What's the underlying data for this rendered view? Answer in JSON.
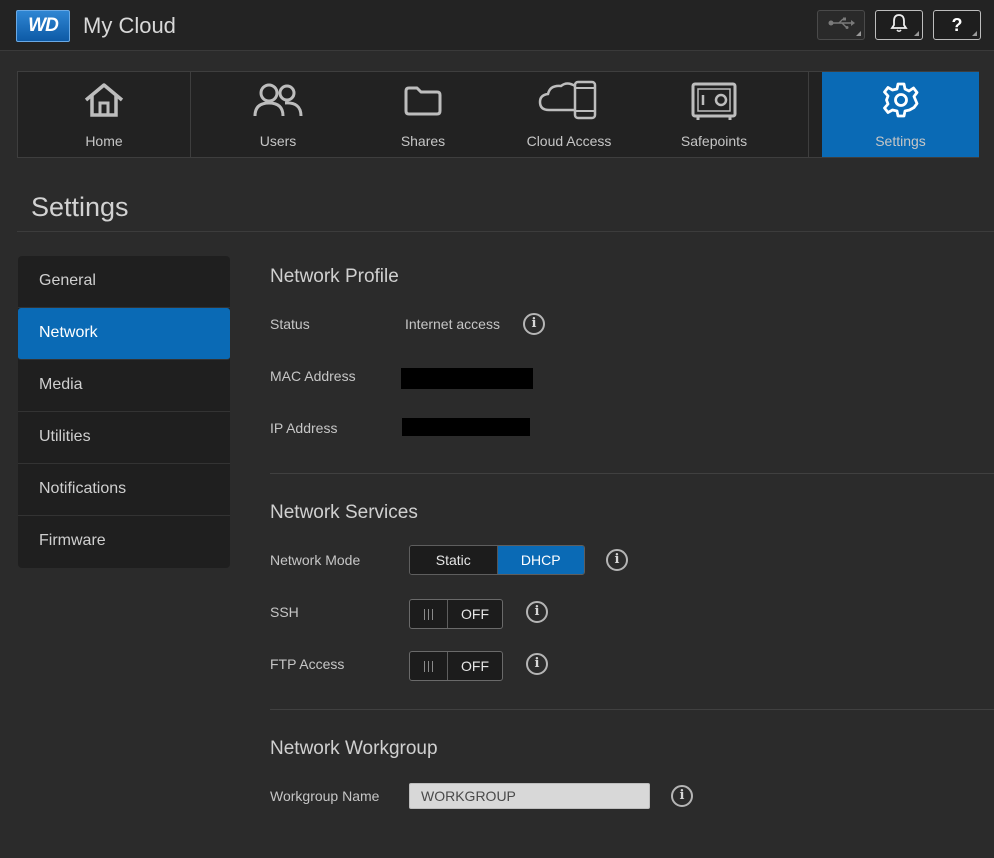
{
  "header": {
    "logo_text": "WD",
    "app_title": "My Cloud",
    "usb_icon": "usb-icon",
    "bell_icon": "bell-icon",
    "help_label": "?"
  },
  "nav": {
    "items": [
      {
        "label": "Home",
        "icon": "home-icon"
      },
      {
        "label": "Users",
        "icon": "users-icon"
      },
      {
        "label": "Shares",
        "icon": "folder-icon"
      },
      {
        "label": "Cloud Access",
        "icon": "cloud-device-icon"
      },
      {
        "label": "Safepoints",
        "icon": "safe-icon"
      },
      {
        "label": "Settings",
        "icon": "gear-icon",
        "active": true
      }
    ]
  },
  "page": {
    "title": "Settings"
  },
  "sidebar": {
    "items": [
      {
        "label": "General"
      },
      {
        "label": "Network",
        "active": true
      },
      {
        "label": "Media"
      },
      {
        "label": "Utilities"
      },
      {
        "label": "Notifications"
      },
      {
        "label": "Firmware"
      }
    ]
  },
  "network_profile": {
    "title": "Network Profile",
    "status_label": "Status",
    "status_value": "Internet access",
    "mac_label": "MAC Address",
    "ip_label": "IP Address"
  },
  "network_services": {
    "title": "Network Services",
    "mode_label": "Network Mode",
    "mode_options": [
      "Static",
      "DHCP"
    ],
    "mode_selected": "DHCP",
    "ssh_label": "SSH",
    "ssh_state": "OFF",
    "ftp_label": "FTP Access",
    "ftp_state": "OFF"
  },
  "network_workgroup": {
    "title": "Network Workgroup",
    "name_label": "Workgroup Name",
    "name_value": "WORKGROUP"
  },
  "colors": {
    "accent": "#0a6ab5",
    "background": "#2b2b2b",
    "panel": "#1f1f1f"
  }
}
